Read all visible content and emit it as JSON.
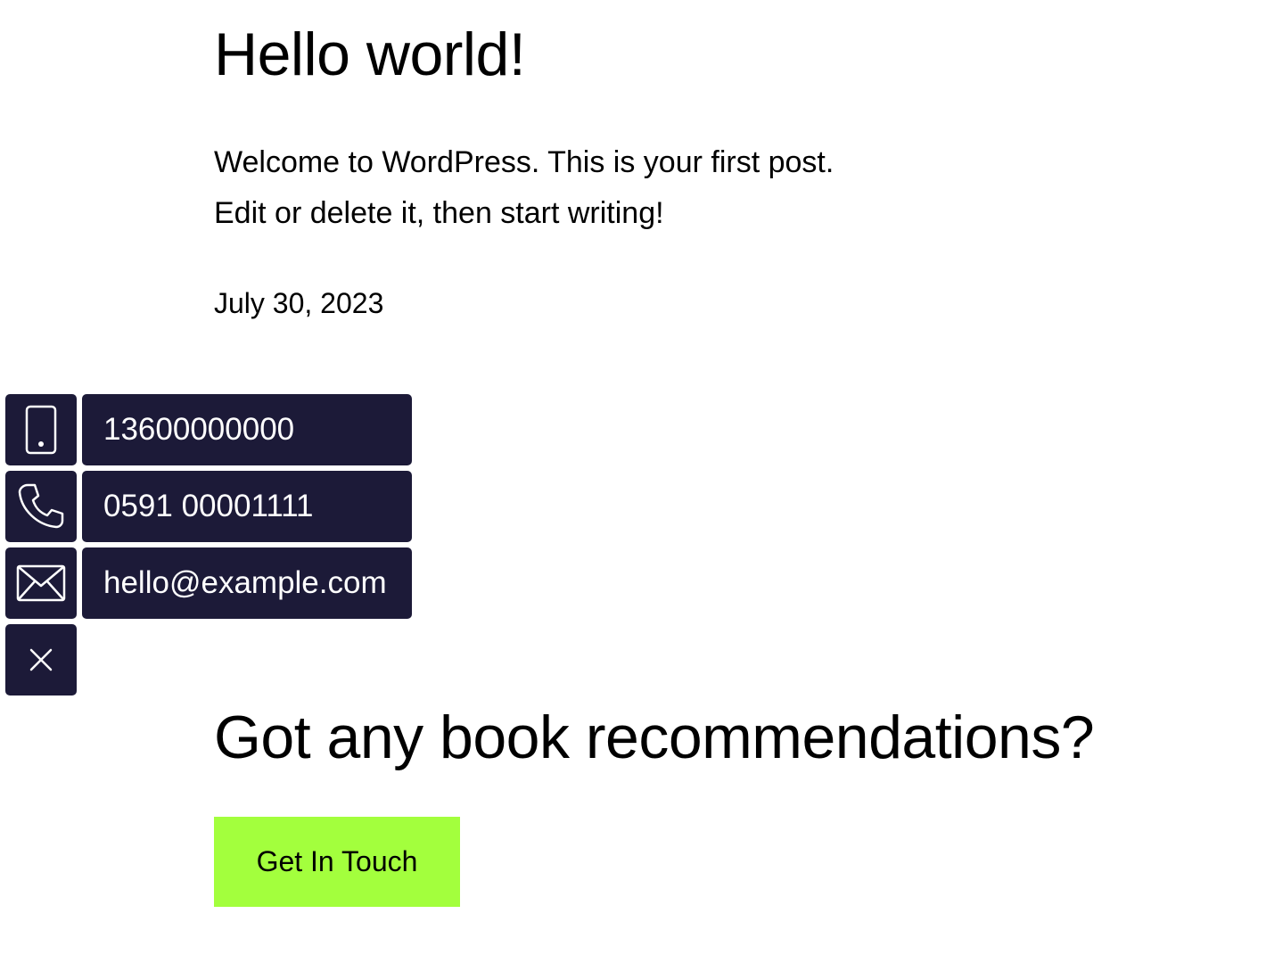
{
  "post": {
    "title": "Hello world!",
    "body_line1": "Welcome to WordPress. This is your first post.",
    "body_line2": "Edit or delete it, then start writing!",
    "date": "July 30, 2023"
  },
  "cta": {
    "heading": "Got any book recommendations?",
    "button_label": "Get In Touch",
    "button_color": "#a3ff3d"
  },
  "contact_widget": {
    "tile_color": "#1c1a38",
    "items": [
      {
        "icon": "mobile-phone-icon",
        "value": "13600000000"
      },
      {
        "icon": "telephone-icon",
        "value": "0591 00001111"
      },
      {
        "icon": "envelope-icon",
        "value": "hello@example.com"
      }
    ],
    "close_icon": "close-icon"
  }
}
